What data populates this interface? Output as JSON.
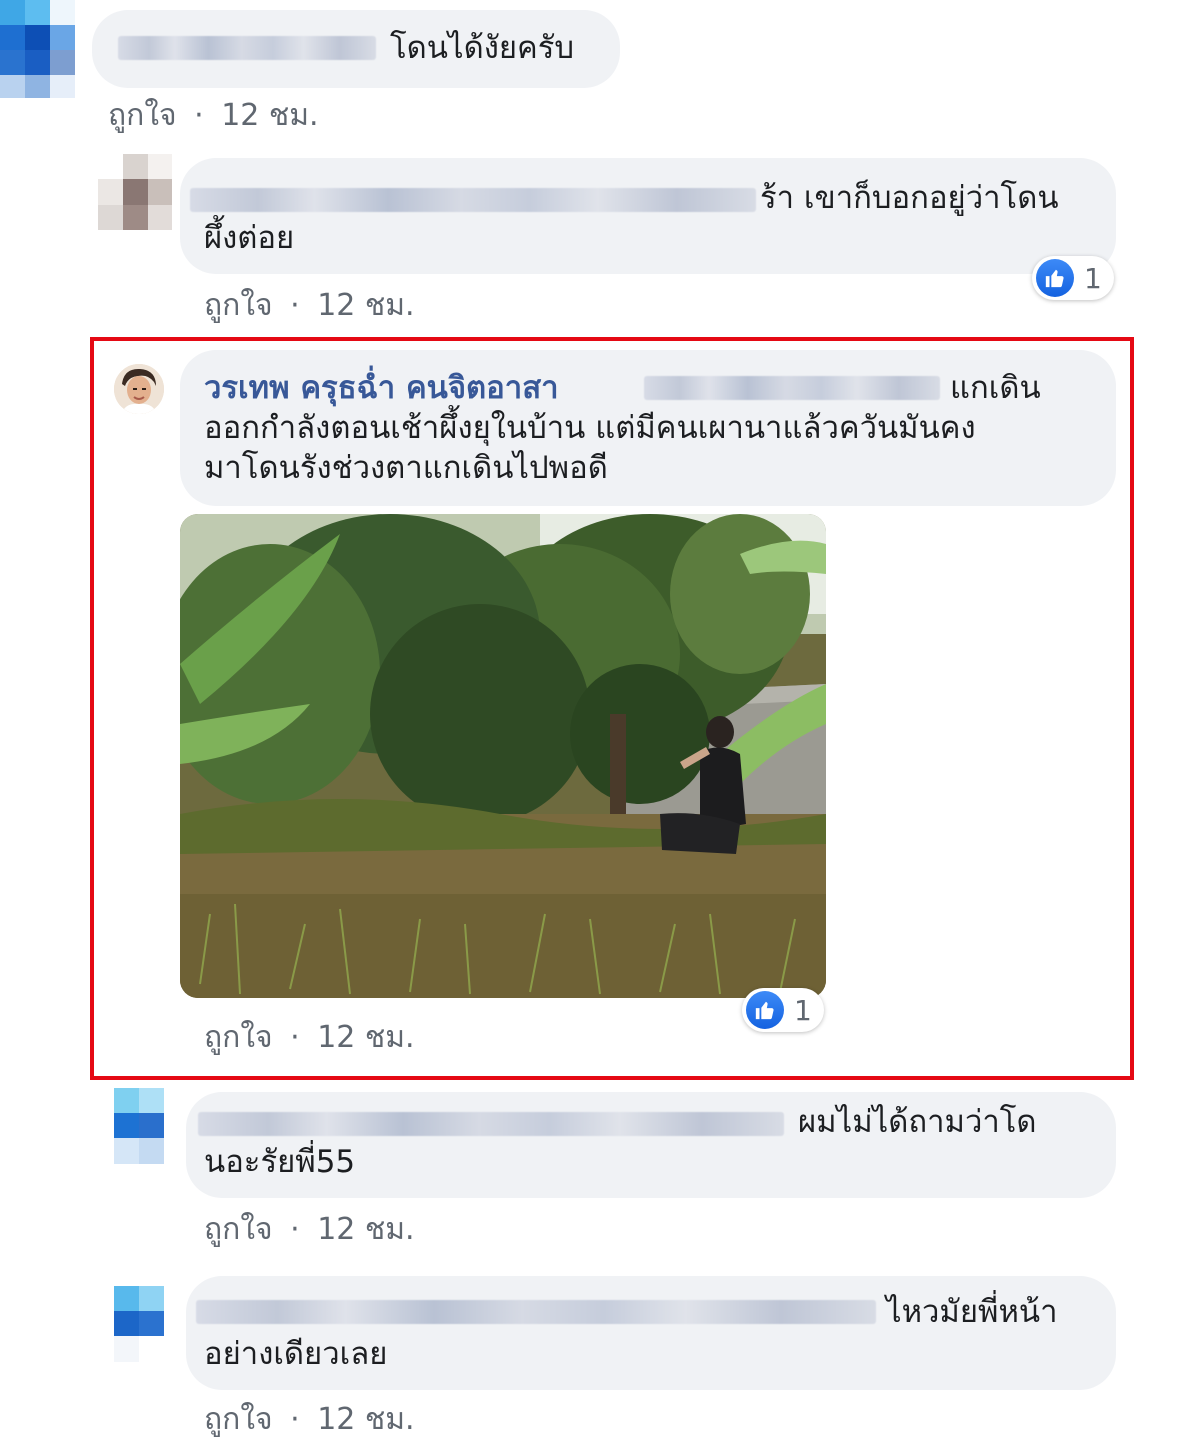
{
  "comments": [
    {
      "text": "โดนได้งัยครับ",
      "like_label": "ถูกใจ",
      "time": "12 ชม."
    },
    {
      "line1": "ร้า เขาก็บอกอยู่ว่าโดน",
      "line2": "ผึ้งต่อย",
      "like_label": "ถูกใจ",
      "time": "12 ชม.",
      "reactions": "1"
    },
    {
      "author": "วรเทพ ครุธฉ่ำ คนจิตอาสา",
      "line1": "แกเดิน",
      "line2": "ออกกำลังตอนเช้าผึ้งยุในบ้าน แต่มีคนเผานาแล้วควันมันคง",
      "line3": "มาโดนรังช่วงตาแกเดินไปพอดี",
      "like_label": "ถูกใจ",
      "time": "12 ชม.",
      "reactions": "1"
    },
    {
      "line1": "ผมไม่ได้ถามว่าโด",
      "line2": "นอะรัยพี่55",
      "like_label": "ถูกใจ",
      "time": "12 ชม."
    },
    {
      "line1": "ไหวมัยพี่หน้า",
      "line2": "อย่างเดียวเลย",
      "like_label": "ถูกใจ",
      "time": "12 ชม."
    }
  ],
  "separator": "·",
  "colors": {
    "bubble": "#f0f2f5",
    "highlight_border": "#e50914",
    "author_name": "#385898",
    "like_blue": "#1877f2"
  }
}
